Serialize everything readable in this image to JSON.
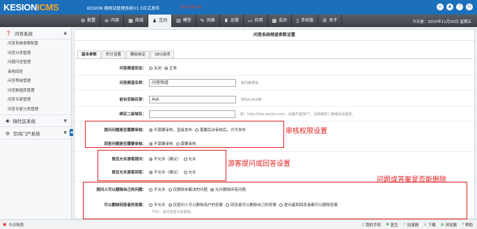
{
  "brand": {
    "logo_main": "KESION",
    "logo_accent": "ICMS"
  },
  "top": {
    "version": "KESION 微网站管理系统V1.0正式发布",
    "date": "2015/4/28"
  },
  "nav": {
    "tabs": [
      {
        "icon": "⚙",
        "label": "配置"
      },
      {
        "icon": "≡",
        "label": "内容"
      },
      {
        "icon": "▦",
        "label": "商城"
      },
      {
        "icon": "♟",
        "label": "互动"
      },
      {
        "icon": "▤",
        "label": "模型"
      },
      {
        "icon": "✎",
        "label": "风格"
      },
      {
        "icon": "♜",
        "label": "运营"
      },
      {
        "icon": "▭",
        "label": "应用"
      },
      {
        "icon": "▩",
        "label": "会员"
      },
      {
        "icon": "▯",
        "label": "手机版"
      },
      {
        "icon": "☰",
        "label": "关于"
      }
    ],
    "active_index": 3,
    "today": "今天是：2015年11月20日 星期五"
  },
  "sidebar": {
    "group1": "问答系统",
    "items": [
      "问答系统参数配置",
      "问答分类管理",
      "问题问答管理",
      "审核回答",
      "问答等级管理",
      "问答数据库管理",
      "问答专家管理",
      "问答专家分类管理"
    ],
    "group2": "微社区系统",
    "group3": "空间门户系统"
  },
  "page": {
    "title": "问答系统频道参数设置",
    "subtabs": [
      "基本参数",
      "积分设置",
      "模板绑定",
      "SEO选项"
    ],
    "active_subtab": 0
  },
  "form": {
    "status_label": "问答频道状态：",
    "status_opts": [
      "关闭",
      "正常"
    ],
    "status_selected": 1,
    "name_label": "问答频道名称：",
    "name_value": "问答频道",
    "name_hint": "如问答频道。",
    "dir_label": "前台安装目录：",
    "dir_value": "Ask",
    "dir_hint": "如bbs,Ask等",
    "domain_label": "绑定二级域名：",
    "domain_value": "",
    "domain_hint": "如：http://Ask.kesion.com，后面不能加\"/\"。没有绑定二级域名请留空。",
    "audit_q_label": "提问问题是否需要审核：",
    "audit_q_opts": [
      "不需要审核，直接发布",
      "需要后台审核后，方可发布"
    ],
    "audit_q_selected": 0,
    "audit_a_label": "回答问题是否需要审核：",
    "audit_a_opts": [
      "不需要审核",
      "需要审核"
    ],
    "audit_a_selected": 0,
    "guest_ask_label": "是否允许游客提问：",
    "guest_ask_opts": [
      "不允许（建议）",
      "允许"
    ],
    "guest_ask_selected": 0,
    "guest_ans_label": "是否允许游客回答：",
    "guest_ans_opts": [
      "不允许（建议）",
      "允许"
    ],
    "guest_ans_selected": 0,
    "del_q_label": "提问人可以删除自己的问题：",
    "del_q_opts": [
      "不允许",
      "仅删除未解决的问题",
      "允许删除所有问题"
    ],
    "del_q_selected": 2,
    "del_a_label": "可以删除回答者的答案：",
    "del_a_opts": [
      "不允许",
      "仅提问人可以删除用户的答案",
      "回答者可以删除自己的答案",
      "提问者和回答者都可以删除答案"
    ],
    "del_a_selected": 1,
    "del_tip": "TIPS：最佳答案不能删除。"
  },
  "annotations": {
    "a1": "审核权限设置",
    "a2": "游客提问或回答设置",
    "a3": "问题或答案是否能删除"
  },
  "bottom": {
    "left": "今日特卖",
    "right": [
      "我的手机",
      "医生",
      "加速器",
      "下载",
      "浏览器",
      "帮助"
    ]
  },
  "colors": {
    "brand": "#1c6fba",
    "annotation": "#e02020"
  }
}
